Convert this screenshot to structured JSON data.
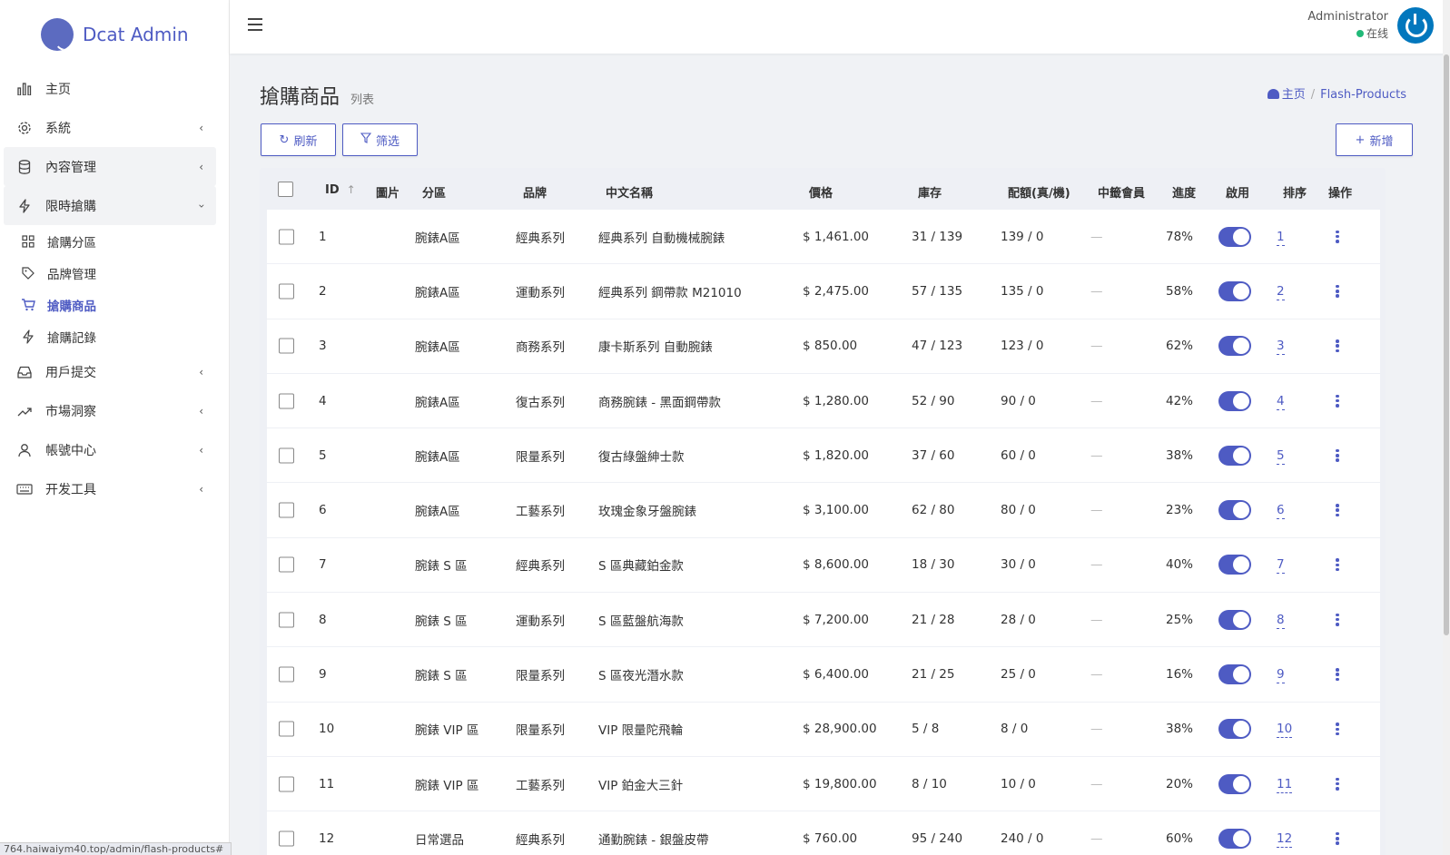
{
  "app": {
    "name": "Dcat Admin",
    "accent": "#4e5bc3"
  },
  "sidebar": {
    "items": [
      {
        "label": "主页",
        "icon": "bar-chart-icon"
      },
      {
        "label": "系統",
        "icon": "gear-icon"
      },
      {
        "label": "內容管理",
        "icon": "database-icon"
      },
      {
        "label": "限時搶購",
        "icon": "lightning-icon"
      },
      {
        "label": "用戶提交",
        "icon": "inbox-icon"
      },
      {
        "label": "市場洞察",
        "icon": "trend-icon"
      },
      {
        "label": "帳號中心",
        "icon": "user-icon"
      },
      {
        "label": "开发工具",
        "icon": "keyboard-icon"
      }
    ],
    "sub_items": [
      {
        "label": "搶購分區",
        "icon": "grid-icon"
      },
      {
        "label": "品牌管理",
        "icon": "tag-icon"
      },
      {
        "label": "搶購商品",
        "icon": "cart-icon"
      },
      {
        "label": "搶購記錄",
        "icon": "lightning-icon"
      }
    ]
  },
  "status_url": "764.haiwaiym40.top/admin/flash-products#",
  "topbar": {
    "user_name": "Administrator",
    "user_status": "在线"
  },
  "page": {
    "title": "搶購商品",
    "subtitle": "列表",
    "breadcrumb": {
      "home": "主页",
      "current": "Flash-Products"
    },
    "buttons": {
      "refresh": "刷新",
      "filter": "筛选",
      "new": "新增"
    }
  },
  "table": {
    "headers": [
      "ID",
      "圖片",
      "分區",
      "品牌",
      "中文名稱",
      "價格",
      "庫存",
      "配額(真/機)",
      "中籤會員",
      "進度",
      "啟用",
      "排序",
      "操作"
    ],
    "dash": "—",
    "rows": [
      {
        "id": "1",
        "zone": "腕錶A區",
        "brand": "經典系列",
        "name": "經典系列 自動機械腕錶",
        "price": "$ 1,461.00",
        "stock": "31 / 139",
        "quota": "139 / 0",
        "progress": "78%",
        "order": "1"
      },
      {
        "id": "2",
        "zone": "腕錶A區",
        "brand": "運動系列",
        "name": "經典系列 鋼帶款 M21010",
        "price": "$ 2,475.00",
        "stock": "57 / 135",
        "quota": "135 / 0",
        "progress": "58%",
        "order": "2"
      },
      {
        "id": "3",
        "zone": "腕錶A區",
        "brand": "商務系列",
        "name": "康卡斯系列 自動腕錶",
        "price": "$ 850.00",
        "stock": "47 / 123",
        "quota": "123 / 0",
        "progress": "62%",
        "order": "3"
      },
      {
        "id": "4",
        "zone": "腕錶A區",
        "brand": "復古系列",
        "name": "商務腕錶 - 黑面鋼帶款",
        "price": "$ 1,280.00",
        "stock": "52 / 90",
        "quota": "90 / 0",
        "progress": "42%",
        "order": "4"
      },
      {
        "id": "5",
        "zone": "腕錶A區",
        "brand": "限量系列",
        "name": "復古綠盤紳士款",
        "price": "$ 1,820.00",
        "stock": "37 / 60",
        "quota": "60 / 0",
        "progress": "38%",
        "order": "5"
      },
      {
        "id": "6",
        "zone": "腕錶A區",
        "brand": "工藝系列",
        "name": "玫瑰金象牙盤腕錶",
        "price": "$ 3,100.00",
        "stock": "62 / 80",
        "quota": "80 / 0",
        "progress": "23%",
        "order": "6"
      },
      {
        "id": "7",
        "zone": "腕錶 S 區",
        "brand": "經典系列",
        "name": "S 區典藏鉑金款",
        "price": "$ 8,600.00",
        "stock": "18 / 30",
        "quota": "30 / 0",
        "progress": "40%",
        "order": "7"
      },
      {
        "id": "8",
        "zone": "腕錶 S 區",
        "brand": "運動系列",
        "name": "S 區藍盤航海款",
        "price": "$ 7,200.00",
        "stock": "21 / 28",
        "quota": "28 / 0",
        "progress": "25%",
        "order": "8"
      },
      {
        "id": "9",
        "zone": "腕錶 S 區",
        "brand": "限量系列",
        "name": "S 區夜光潛水款",
        "price": "$ 6,400.00",
        "stock": "21 / 25",
        "quota": "25 / 0",
        "progress": "16%",
        "order": "9"
      },
      {
        "id": "10",
        "zone": "腕錶 VIP 區",
        "brand": "限量系列",
        "name": "VIP 限量陀飛輪",
        "price": "$ 28,900.00",
        "stock": "5 / 8",
        "quota": "8 / 0",
        "progress": "38%",
        "order": "10"
      },
      {
        "id": "11",
        "zone": "腕錶 VIP 區",
        "brand": "工藝系列",
        "name": "VIP 鉑金大三針",
        "price": "$ 19,800.00",
        "stock": "8 / 10",
        "quota": "10 / 0",
        "progress": "20%",
        "order": "11"
      },
      {
        "id": "12",
        "zone": "日常選品",
        "brand": "經典系列",
        "name": "通勤腕錶 - 銀盤皮帶",
        "price": "$ 760.00",
        "stock": "95 / 240",
        "quota": "240 / 0",
        "progress": "60%",
        "order": "12"
      }
    ]
  }
}
